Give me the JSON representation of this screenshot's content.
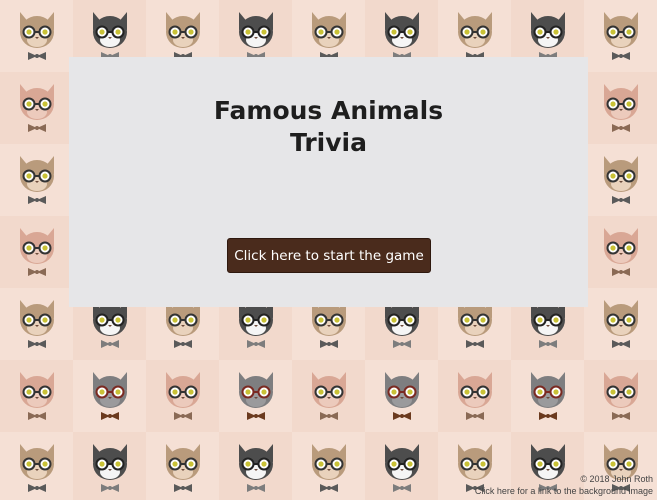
{
  "panel": {
    "title_line1": "Famous Animals",
    "title_line2": "Trivia",
    "start_label": "Click here to start the game"
  },
  "footer": {
    "copyright": "© 2018 John Roth",
    "bg_link": "Click here for a link to the background image"
  },
  "colors": {
    "panel_bg": "#e6e6e8",
    "button_bg": "#4a2b1c",
    "page_bg": "#f3ddd2"
  },
  "background": {
    "pattern_icon": "hipster-cat-with-glasses-icon",
    "cat_variants": [
      "tan-cat",
      "grey-white-cat",
      "pink-sphynx-cat",
      "grey-cat-red-glasses"
    ]
  }
}
